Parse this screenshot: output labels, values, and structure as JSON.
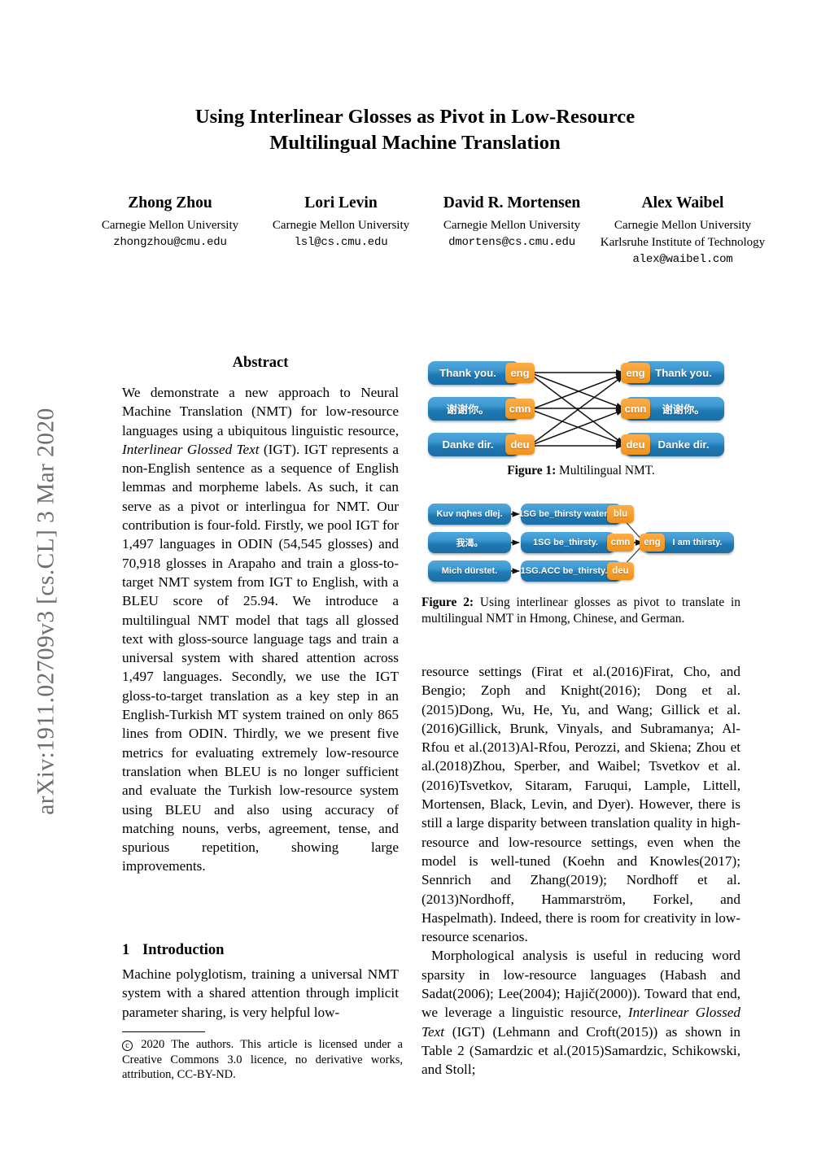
{
  "arxiv_stamp": "arXiv:1911.02709v3  [cs.CL]  3 Mar 2020",
  "title": {
    "line1": "Using Interlinear Glosses as Pivot in Low-Resource",
    "line2": "Multilingual Machine Translation"
  },
  "authors": [
    {
      "name": "Zhong Zhou",
      "affiliation": "Carnegie Mellon University",
      "affiliation2": "",
      "email": "zhongzhou@cmu.edu"
    },
    {
      "name": "Lori Levin",
      "affiliation": "Carnegie Mellon University",
      "affiliation2": "",
      "email": "lsl@cs.cmu.edu"
    },
    {
      "name": "David R. Mortensen",
      "affiliation": "Carnegie Mellon University",
      "affiliation2": "",
      "email": "dmortens@cs.cmu.edu"
    },
    {
      "name": "Alex Waibel",
      "affiliation": "Carnegie Mellon University",
      "affiliation2": "Karlsruhe Institute of Technology",
      "email": "alex@waibel.com"
    }
  ],
  "abstract": {
    "heading": "Abstract",
    "part1": "We demonstrate a new approach to Neural Machine Translation (NMT) for low-resource languages using a ubiquitous linguistic resource, ",
    "italic1": "Interlinear Glossed Text",
    "part2": " (IGT). IGT represents a non-English sentence as a sequence of English lemmas and morpheme labels. As such, it can serve as a pivot or interlingua for NMT. Our contribution is four-fold. Firstly, we pool IGT for 1,497 languages in ODIN (54,545 glosses) and 70,918 glosses in Arapaho and train a gloss-to-target NMT system from IGT to English, with a BLEU score of 25.94. We introduce a multilingual NMT model that tags all glossed text with gloss-source language tags and train a universal system with shared attention across 1,497 languages. Secondly, we use the IGT gloss-to-target translation as a key step in an English-Turkish MT system trained on only 865 lines from ODIN. Thirdly, we we present five metrics for evaluating extremely low-resource translation when BLEU is no longer sufficient and evaluate the Turkish low-resource system using BLEU and also using accuracy of matching nouns, verbs, agreement, tense, and spurious repetition, showing large improvements."
  },
  "introduction": {
    "number": "1",
    "heading": "Introduction",
    "paragraph": "Machine polyglotism, training a universal NMT system with a shared attention through implicit parameter sharing, is very helpful low-"
  },
  "footnote": {
    "mark": "c",
    "text": " 2020 The authors. This article is licensed under a Creative Commons 3.0 licence, no derivative works, attribution, CC-BY-ND."
  },
  "right_column": {
    "para1": "resource settings (Firat et al.(2016)Firat, Cho, and Bengio; Zoph and Knight(2016); Dong et al.(2015)Dong, Wu, He, Yu, and Wang; Gillick et al.(2016)Gillick, Brunk, Vinyals, and Subramanya; Al-Rfou et al.(2013)Al-Rfou, Perozzi, and Skiena; Zhou et al.(2018)Zhou, Sperber, and Waibel; Tsvetkov et al.(2016)Tsvetkov, Sitaram, Faruqui, Lample, Littell, Mortensen, Black, Levin, and Dyer). However, there is still a large disparity between translation quality in high-resource and low-resource settings, even when the model is well-tuned (Koehn and Knowles(2017); Sennrich and Zhang(2019); Nordhoff et al.(2013)Nordhoff, Hammarström, Forkel, and Haspelmath). Indeed, there is room for creativity in low-resource scenarios.",
    "para2_a": "Morphological analysis is useful in reducing word sparsity in low-resource languages (Habash and Sadat(2006); Lee(2004); Hajič(2000)). Toward that end, we leverage a linguistic resource, ",
    "para2_italic": "Interlinear Glossed Text",
    "para2_b": " (IGT) (Lehmann and Croft(2015)) as shown in Table 2 (Samardzic et al.(2015)Samardzic, Schikowski, and Stoll;"
  },
  "figure1": {
    "caption_label": "Figure 1:",
    "caption_text": " Multilingual NMT.",
    "left_nodes": [
      {
        "text": "Thank you.",
        "tag": "eng"
      },
      {
        "text": "谢谢你。",
        "tag": "cmn"
      },
      {
        "text": "Danke dir.",
        "tag": "deu"
      }
    ],
    "right_nodes": [
      {
        "tag": "eng",
        "text": "Thank you."
      },
      {
        "tag": "cmn",
        "text": "谢谢你。"
      },
      {
        "tag": "deu",
        "text": "Danke dir."
      }
    ]
  },
  "figure2": {
    "caption_label": "Figure 2:",
    "caption_text": " Using interlinear glosses as pivot to translate in multilingual NMT in Hmong, Chinese, and German.",
    "source_nodes": [
      "Kuv nqhes dlej.",
      "我渴。",
      "Mich dürstet."
    ],
    "gloss_nodes": [
      {
        "text": "1SG be_thirsty water.",
        "tag": "blu"
      },
      {
        "text": "1SG be_thirsty.",
        "tag": "cmn"
      },
      {
        "text": "1SG.ACC be_thirsty.",
        "tag": "deu"
      }
    ],
    "target_node": {
      "tag": "eng",
      "text": "I am thirsty."
    }
  },
  "colors": {
    "node_blue": "#2d8cc6",
    "tag_orange": "#f59f24",
    "stamp_gray": "#6e6e6e"
  }
}
